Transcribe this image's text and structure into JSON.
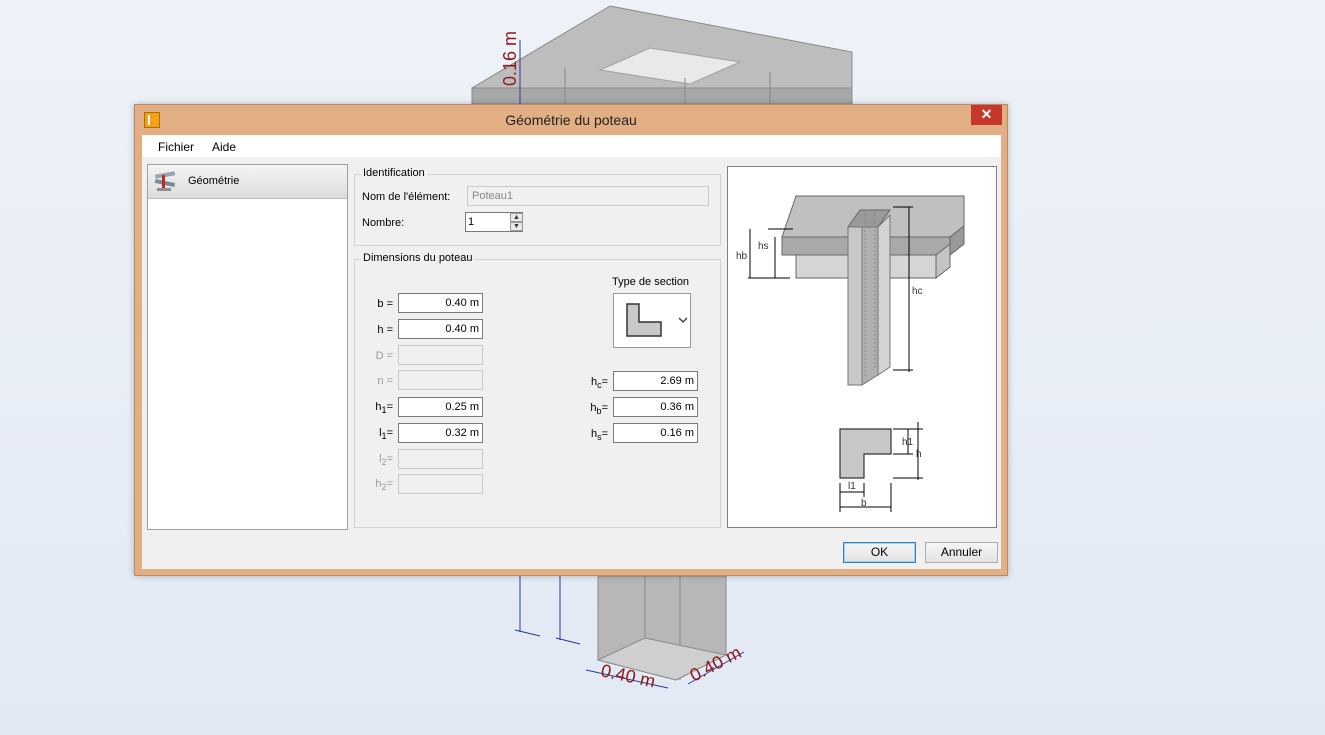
{
  "scene": {
    "dim_top": "0.16 m",
    "dim_bottom_left": "0.40 m",
    "dim_bottom_right": "0.40 m"
  },
  "dialog": {
    "title": "Géométrie du poteau",
    "close_symbol": "✕",
    "menu": [
      "Fichier",
      "Aide"
    ],
    "nav": {
      "item_label": "Géométrie",
      "item_icon": "geometry-tools-icon"
    },
    "identification": {
      "group_title": "Identification",
      "name_label": "Nom de l'élément:",
      "name_value": "Poteau1",
      "count_label": "Nombre:",
      "count_value": "1"
    },
    "dimensions": {
      "group_title": "Dimensions du poteau",
      "section_type_label": "Type de section",
      "b": {
        "label": "b =",
        "value": "0.40 m"
      },
      "h": {
        "label": "h =",
        "value": "0.40 m"
      },
      "D": {
        "label": "D =",
        "value": ""
      },
      "n": {
        "label": "n =",
        "value": ""
      },
      "h1": {
        "label_main": "h",
        "label_sub": "1",
        "eq": "=",
        "value": "0.25 m"
      },
      "l1": {
        "label_main": "l",
        "label_sub": "1",
        "eq": "=",
        "value": "0.32 m"
      },
      "l2": {
        "label_main": "l",
        "label_sub": "2",
        "eq": "=",
        "value": ""
      },
      "h2": {
        "label_main": "h",
        "label_sub": "2",
        "eq": "=",
        "value": ""
      },
      "hc": {
        "label_main": "h",
        "label_sub": "c",
        "eq": "=",
        "value": "2.69 m"
      },
      "hb": {
        "label_main": "h",
        "label_sub": "b",
        "eq": "=",
        "value": "0.36 m"
      },
      "hs": {
        "label_main": "h",
        "label_sub": "s",
        "eq": "=",
        "value": "0.16 m"
      }
    },
    "preview": {
      "hs": "hs",
      "hb": "hb",
      "hc": "hc",
      "h1": "h1",
      "h": "h",
      "l1": "l1",
      "b": "b"
    },
    "buttons": {
      "ok": "OK",
      "cancel": "Annuler"
    }
  }
}
